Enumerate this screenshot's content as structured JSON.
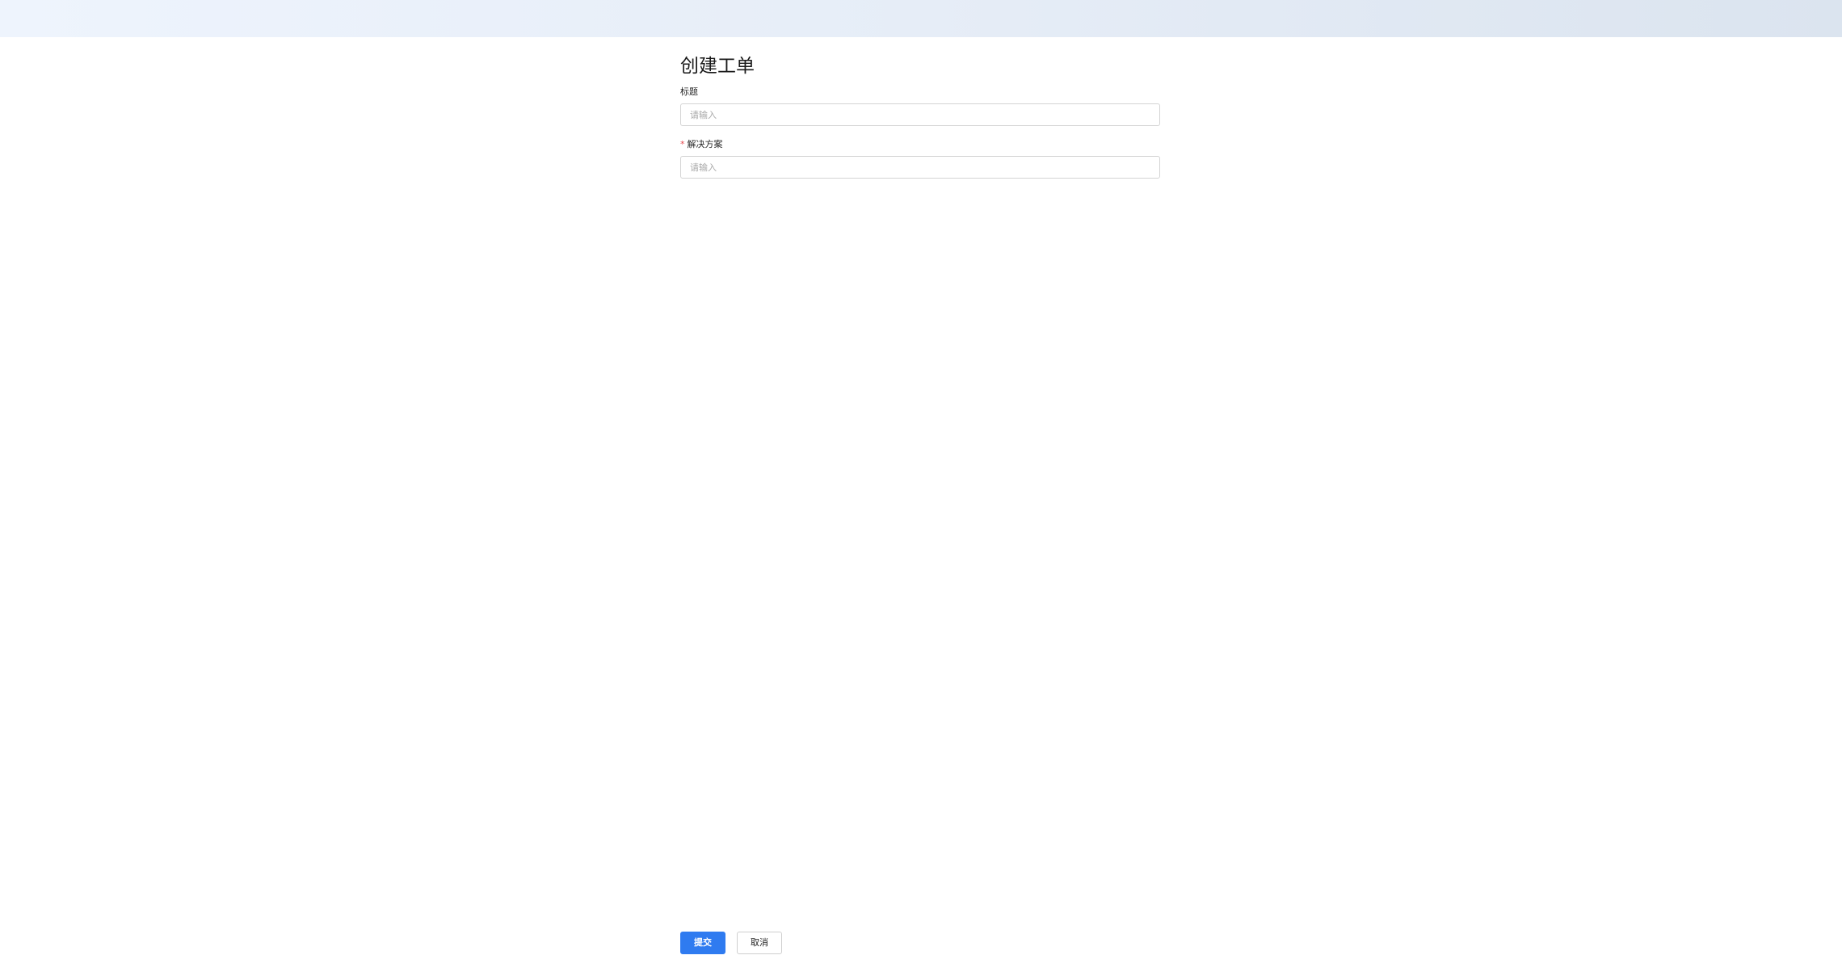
{
  "page": {
    "title": "创建工单"
  },
  "form": {
    "title_field": {
      "label": "标题",
      "value": "",
      "placeholder": "请输入"
    },
    "solution_field": {
      "required_mark": "*",
      "label": "解决方案",
      "value": "",
      "placeholder": "请输入"
    }
  },
  "actions": {
    "submit_label": "提交",
    "cancel_label": "取消"
  },
  "colors": {
    "primary": "#2f7bf0",
    "required": "#e5484d",
    "banner_start": "#eef4fd",
    "banner_end": "#dbe4ef"
  }
}
